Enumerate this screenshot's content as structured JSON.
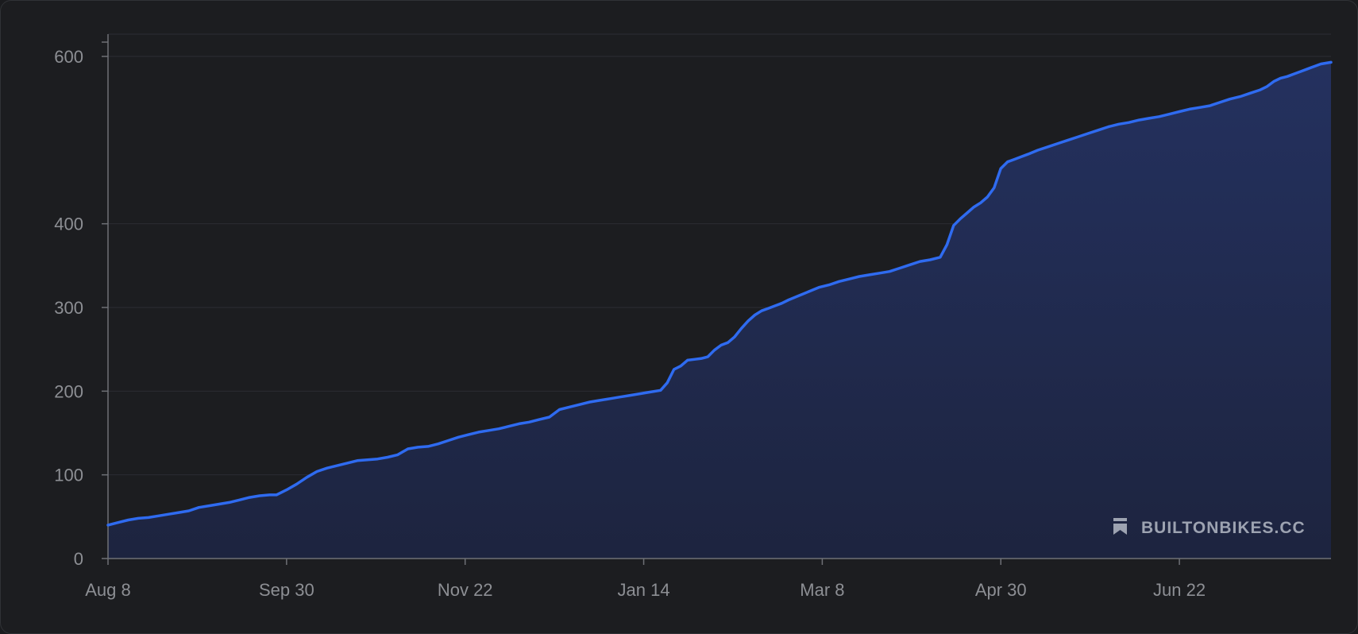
{
  "watermark": {
    "text": "BUILTONBIKES.CC",
    "icon": "flag-bookmark-icon"
  },
  "colors": {
    "line": "#2f6bf0",
    "fill_top": "#23305e",
    "fill_bottom": "#1d2440",
    "grid": "#2b2d33",
    "axis": "#6e7076"
  },
  "chart_data": {
    "type": "area",
    "title": "",
    "xlabel": "",
    "ylabel": "",
    "x_ticks": [
      "Aug 8",
      "Sep 30",
      "Nov 22",
      "Jan 14",
      "Mar 8",
      "Apr 30",
      "Jun 22"
    ],
    "y_ticks": [
      0,
      100,
      200,
      300,
      400,
      600
    ],
    "ylim": [
      0,
      612
    ],
    "x_range_days": [
      0,
      363
    ],
    "grid": true,
    "series": [
      {
        "name": "",
        "points": [
          [
            0,
            40
          ],
          [
            3,
            43
          ],
          [
            6,
            46
          ],
          [
            9,
            48
          ],
          [
            12,
            49
          ],
          [
            15,
            51
          ],
          [
            18,
            53
          ],
          [
            21,
            55
          ],
          [
            24,
            57
          ],
          [
            27,
            61
          ],
          [
            30,
            63
          ],
          [
            33,
            65
          ],
          [
            36,
            67
          ],
          [
            39,
            70
          ],
          [
            42,
            73
          ],
          [
            45,
            75
          ],
          [
            48,
            76
          ],
          [
            50,
            76
          ],
          [
            53,
            82
          ],
          [
            56,
            89
          ],
          [
            59,
            97
          ],
          [
            62,
            104
          ],
          [
            65,
            108
          ],
          [
            68,
            111
          ],
          [
            71,
            114
          ],
          [
            74,
            117
          ],
          [
            77,
            118
          ],
          [
            80,
            119
          ],
          [
            83,
            121
          ],
          [
            86,
            124
          ],
          [
            89,
            131
          ],
          [
            92,
            133
          ],
          [
            95,
            134
          ],
          [
            98,
            137
          ],
          [
            101,
            141
          ],
          [
            104,
            145
          ],
          [
            107,
            148
          ],
          [
            110,
            151
          ],
          [
            113,
            153
          ],
          [
            116,
            155
          ],
          [
            119,
            158
          ],
          [
            122,
            161
          ],
          [
            125,
            163
          ],
          [
            128,
            166
          ],
          [
            131,
            169
          ],
          [
            134,
            178
          ],
          [
            137,
            181
          ],
          [
            140,
            184
          ],
          [
            143,
            187
          ],
          [
            146,
            189
          ],
          [
            149,
            191
          ],
          [
            152,
            193
          ],
          [
            155,
            195
          ],
          [
            158,
            197
          ],
          [
            161,
            199
          ],
          [
            164,
            201
          ],
          [
            166,
            210
          ],
          [
            168,
            226
          ],
          [
            170,
            230
          ],
          [
            172,
            237
          ],
          [
            174,
            238
          ],
          [
            176,
            239
          ],
          [
            178,
            241
          ],
          [
            180,
            249
          ],
          [
            182,
            255
          ],
          [
            184,
            258
          ],
          [
            186,
            265
          ],
          [
            188,
            275
          ],
          [
            190,
            284
          ],
          [
            192,
            291
          ],
          [
            194,
            296
          ],
          [
            196,
            299
          ],
          [
            198,
            302
          ],
          [
            200,
            305
          ],
          [
            202,
            309
          ],
          [
            205,
            314
          ],
          [
            208,
            319
          ],
          [
            211,
            324
          ],
          [
            214,
            327
          ],
          [
            217,
            331
          ],
          [
            220,
            334
          ],
          [
            223,
            337
          ],
          [
            226,
            339
          ],
          [
            229,
            341
          ],
          [
            232,
            343
          ],
          [
            235,
            347
          ],
          [
            238,
            351
          ],
          [
            241,
            355
          ],
          [
            244,
            357
          ],
          [
            247,
            360
          ],
          [
            249,
            375
          ],
          [
            251,
            398
          ],
          [
            253,
            406
          ],
          [
            255,
            413
          ],
          [
            257,
            420
          ],
          [
            259,
            425
          ],
          [
            261,
            432
          ],
          [
            263,
            443
          ],
          [
            265,
            466
          ],
          [
            267,
            474
          ],
          [
            269,
            477
          ],
          [
            271,
            480
          ],
          [
            273,
            483
          ],
          [
            276,
            488
          ],
          [
            279,
            492
          ],
          [
            282,
            496
          ],
          [
            285,
            500
          ],
          [
            288,
            504
          ],
          [
            291,
            508
          ],
          [
            294,
            512
          ],
          [
            297,
            516
          ],
          [
            300,
            519
          ],
          [
            303,
            521
          ],
          [
            306,
            524
          ],
          [
            309,
            526
          ],
          [
            312,
            528
          ],
          [
            315,
            531
          ],
          [
            318,
            534
          ],
          [
            321,
            537
          ],
          [
            324,
            539
          ],
          [
            327,
            541
          ],
          [
            330,
            545
          ],
          [
            333,
            549
          ],
          [
            336,
            552
          ],
          [
            339,
            556
          ],
          [
            342,
            560
          ],
          [
            344,
            564
          ],
          [
            346,
            570
          ],
          [
            348,
            574
          ],
          [
            350,
            576
          ],
          [
            352,
            579
          ],
          [
            354,
            582
          ],
          [
            356,
            585
          ],
          [
            358,
            588
          ],
          [
            360,
            591
          ],
          [
            363,
            593
          ]
        ]
      }
    ]
  }
}
